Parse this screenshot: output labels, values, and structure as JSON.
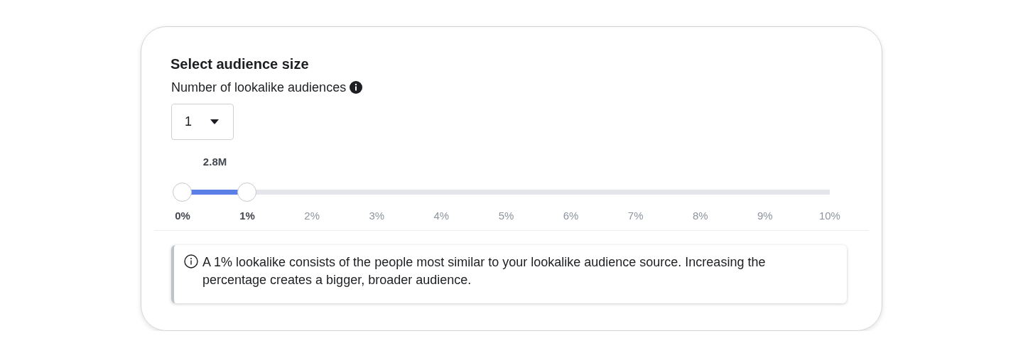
{
  "card": {
    "title": "Select audience size",
    "field_label": "Number of lookalike audiences",
    "dropdown": {
      "value": "1"
    },
    "slider": {
      "value_label": "2.8M",
      "thumbs": [
        {
          "level": 0
        },
        {
          "level": 0.1
        }
      ],
      "ticks": [
        {
          "label": "0%",
          "active": true
        },
        {
          "label": "1%",
          "active": true
        },
        {
          "label": "2%",
          "active": false
        },
        {
          "label": "3%",
          "active": false
        },
        {
          "label": "4%",
          "active": false
        },
        {
          "label": "5%",
          "active": false
        },
        {
          "label": "6%",
          "active": false
        },
        {
          "label": "7%",
          "active": false
        },
        {
          "label": "8%",
          "active": false
        },
        {
          "label": "9%",
          "active": false
        },
        {
          "label": "10%",
          "active": false
        }
      ]
    },
    "note": "A 1% lookalike consists of the people most similar to your lookalike audience source. Increasing the percentage creates a bigger, broader audience."
  }
}
